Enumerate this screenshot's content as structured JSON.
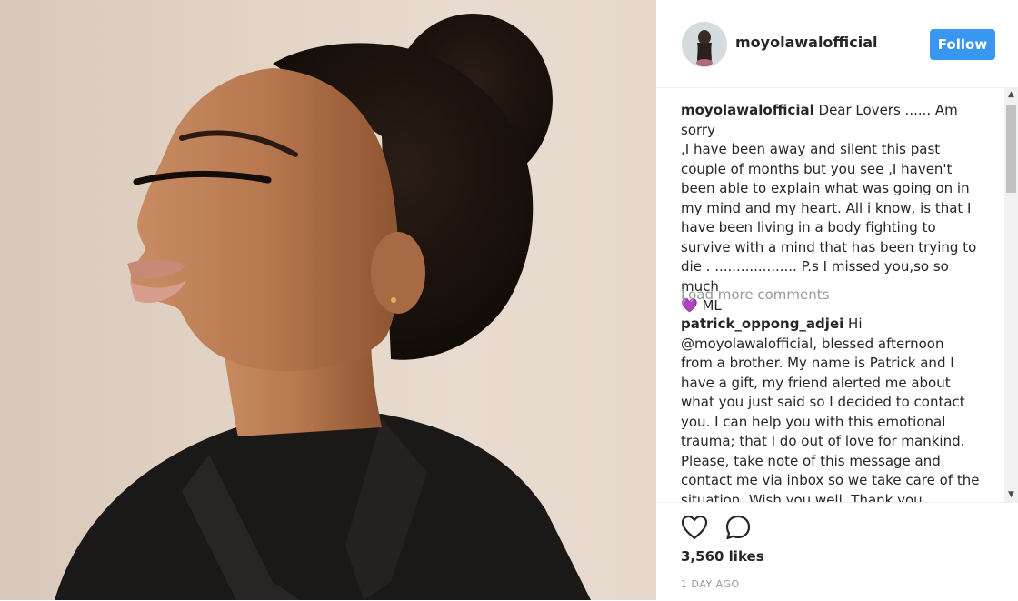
{
  "post": {
    "username": "moyolawalofficial",
    "follow_label": "Follow"
  },
  "caption": {
    "username": "moyolawalofficial",
    "lines": [
      "Dear Lovers ...... Am sorry",
      ",I have been away and silent this past",
      "couple of months but you see ,I haven't",
      "been able to explain what was going on in",
      "my mind and my heart. All i know, is that I",
      "have been living in a body fighting to",
      "survive with a mind that has been trying to",
      "die . ................... P.s I missed you,so so much"
    ],
    "sign_emoji": "💜",
    "sign_text": "ML"
  },
  "load_more": "Load more comments",
  "comment": {
    "username": "patrick_oppong_adjei",
    "lines": [
      "Hi",
      "@moyolawalofficial, blessed afternoon",
      "from a brother. My name is Patrick and I",
      "have a gift, my friend alerted me about",
      "what you just said so I decided to contact",
      "you. I can help you with this emotional",
      "trauma; that I do out of love for mankind.",
      "Please, take note of this message and",
      "contact me via inbox so we take care of the",
      "situation. Wish you well. Thank you"
    ]
  },
  "likes": "3,560 likes",
  "time": "1 DAY AGO",
  "icons": {
    "like": "heart-icon",
    "comment": "comment-bubble-icon"
  },
  "colors": {
    "follow": "#3897f0",
    "heart_emoji": "#8a6fd1",
    "muted": "#999999"
  }
}
